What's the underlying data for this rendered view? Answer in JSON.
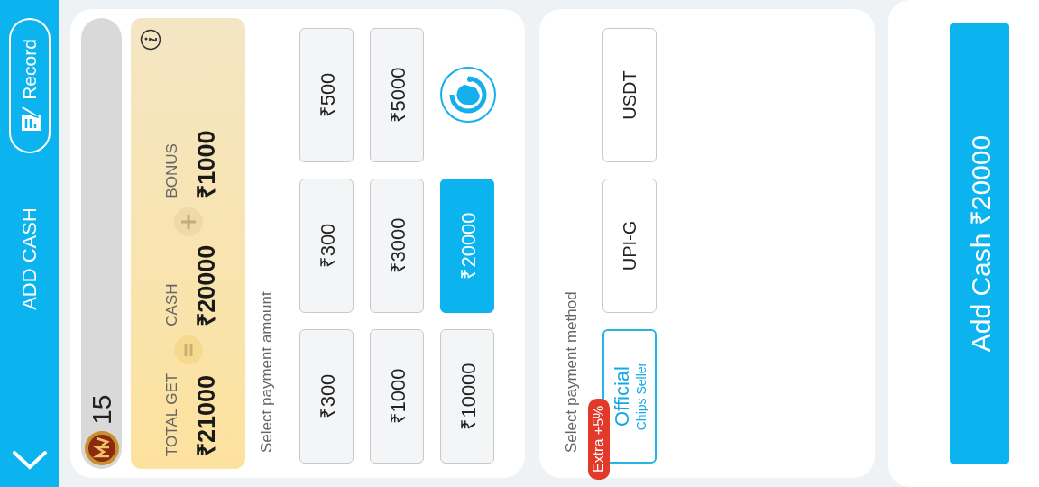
{
  "header": {
    "title": "ADD CASH",
    "record_button": "Record"
  },
  "balance": {
    "value": "15"
  },
  "summary": {
    "items": [
      {
        "label": "TOTAL GET",
        "value": "₹21000"
      },
      {
        "label": "CASH",
        "value": "₹20000"
      },
      {
        "label": "BONUS",
        "value": "₹1000"
      }
    ]
  },
  "amount": {
    "label": "Select payment amount",
    "options": [
      {
        "kind": "amount",
        "label": "₹300",
        "selected": false
      },
      {
        "kind": "amount",
        "label": "₹300",
        "selected": false
      },
      {
        "kind": "amount",
        "label": "₹500",
        "selected": false
      },
      {
        "kind": "amount",
        "label": "₹1000",
        "selected": false
      },
      {
        "kind": "amount",
        "label": "₹3000",
        "selected": false
      },
      {
        "kind": "amount",
        "label": "₹5000",
        "selected": false
      },
      {
        "kind": "amount",
        "label": "₹10000",
        "selected": false
      },
      {
        "kind": "amount",
        "label": "₹20000",
        "selected": true
      },
      {
        "kind": "support"
      }
    ]
  },
  "method": {
    "label": "Select payment method",
    "options": [
      {
        "title": "Official",
        "subtitle": "Chips Seller",
        "badge": "Extra +5%",
        "selected": true
      },
      {
        "title": "UPI-G",
        "selected": false
      },
      {
        "title": "USDT",
        "selected": false
      }
    ]
  },
  "submit": {
    "label": "Add Cash ₹20000"
  }
}
